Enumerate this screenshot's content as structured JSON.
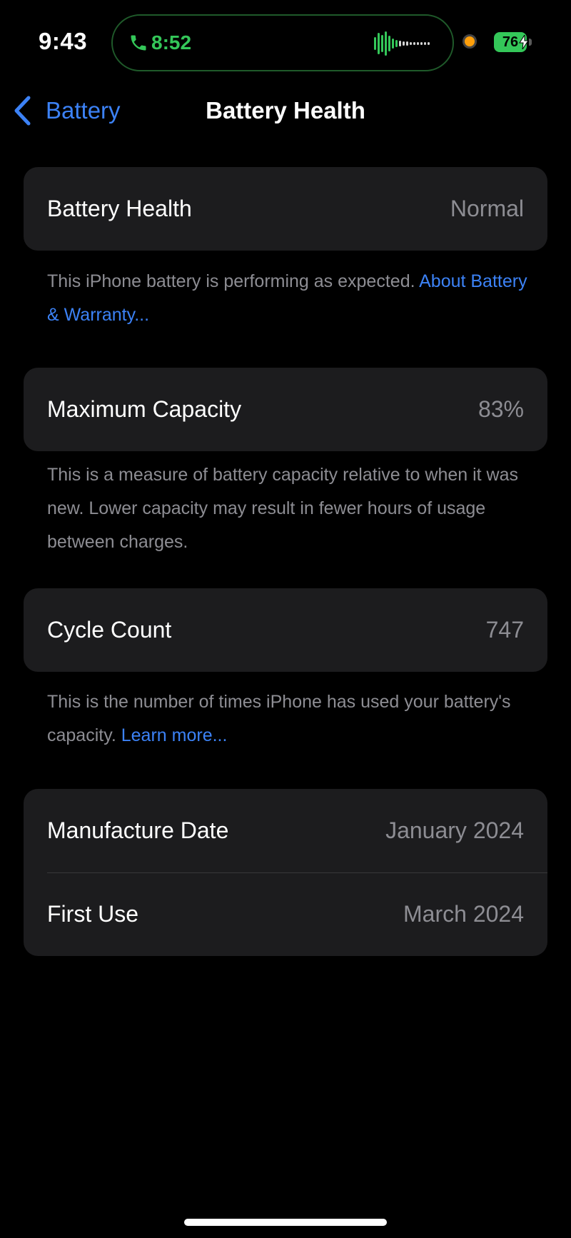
{
  "status_bar": {
    "time": "9:43",
    "call_time": "8:52",
    "battery_level": "76",
    "colors": {
      "call_green": "#34c759",
      "recording_dot": "#ff9f0a"
    }
  },
  "nav": {
    "back_label": "Battery",
    "title": "Battery Health"
  },
  "sections": {
    "health": {
      "label": "Battery Health",
      "value": "Normal",
      "footnote_text": "This iPhone battery is performing as expected. ",
      "footnote_link": "About Battery & Warranty..."
    },
    "capacity": {
      "label": "Maximum Capacity",
      "value": "83%",
      "footnote_text": "This is a measure of battery capacity relative to when it was new. Lower capacity may result in fewer hours of usage between charges."
    },
    "cycles": {
      "label": "Cycle Count",
      "value": "747",
      "footnote_text": "This is the number of times iPhone has used your battery's capacity. ",
      "footnote_link": "Learn more..."
    },
    "dates": {
      "manufacture_label": "Manufacture Date",
      "manufacture_value": "January 2024",
      "first_use_label": "First Use",
      "first_use_value": "March 2024"
    }
  },
  "theme": {
    "accent": "#3c82f6",
    "card_background": "#1c1c1e",
    "secondary_text": "#8d8d93"
  }
}
